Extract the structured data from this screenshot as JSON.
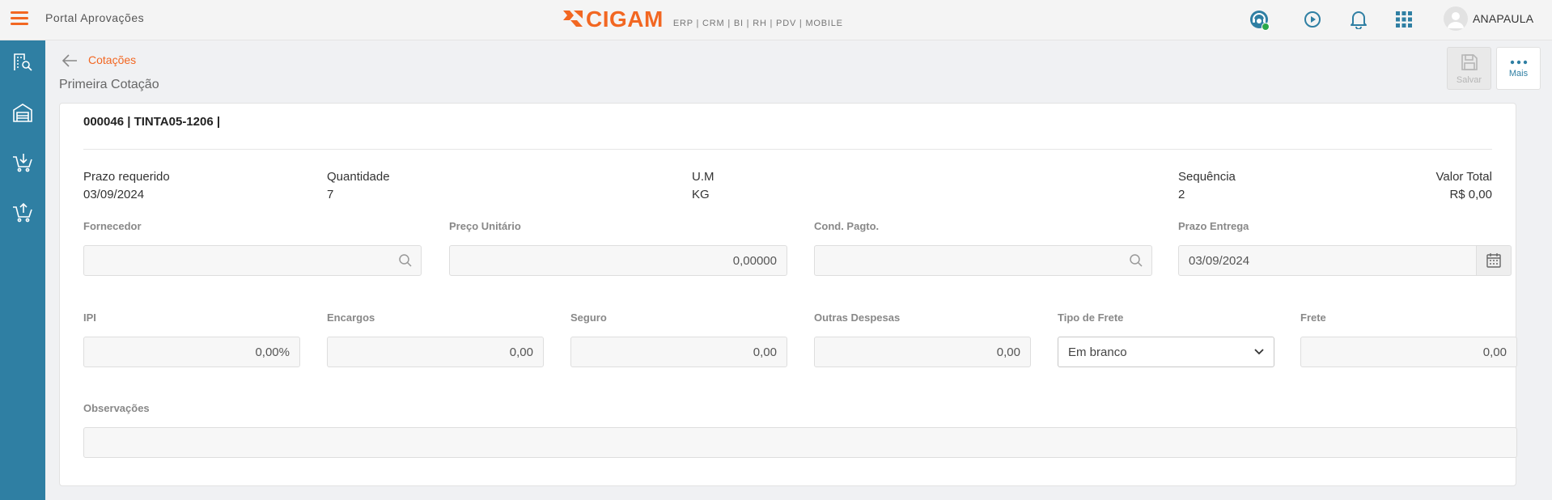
{
  "header": {
    "app_title": "Portal Aprovações",
    "logo_text": "CIGAM",
    "logo_tagline": "ERP | CRM | BI | RH | PDV | MOBILE",
    "user_name": "ANAPAULA"
  },
  "nav": {
    "breadcrumb": "Cotações",
    "page_title": "Primeira Cotação"
  },
  "actions": {
    "save_label": "Salvar",
    "more_label": "Mais"
  },
  "record": {
    "title": "000046 | TINTA05-1206 |",
    "prazo_requerido_label": "Prazo requerido",
    "prazo_requerido_value": "03/09/2024",
    "quantidade_label": "Quantidade",
    "quantidade_value": "7",
    "um_label": "U.M",
    "um_value": "KG",
    "sequencia_label": "Sequência",
    "sequencia_value": "2",
    "valor_total_label": "Valor Total",
    "valor_total_value": "R$ 0,00"
  },
  "form": {
    "fornecedor_label": "Fornecedor",
    "fornecedor_value": "",
    "preco_unitario_label": "Preço Unitário",
    "preco_unitario_value": "0,00000",
    "cond_pagto_label": "Cond. Pagto.",
    "cond_pagto_value": "",
    "prazo_entrega_label": "Prazo Entrega",
    "prazo_entrega_value": "03/09/2024",
    "ipi_label": "IPI",
    "ipi_value": "0,00%",
    "encargos_label": "Encargos",
    "encargos_value": "0,00",
    "seguro_label": "Seguro",
    "seguro_value": "0,00",
    "outras_despesas_label": "Outras Despesas",
    "outras_despesas_value": "0,00",
    "tipo_frete_label": "Tipo de Frete",
    "tipo_frete_value": "Em branco",
    "frete_label": "Frete",
    "frete_value": "0,00",
    "observacoes_label": "Observações",
    "observacoes_value": ""
  },
  "colors": {
    "brand_orange": "#f26722",
    "sidebar_blue": "#2f7fa3",
    "status_online": "#2aa84a"
  },
  "icons": {
    "menu": "hamburger-icon",
    "support": "support-agent-icon",
    "play": "play-circle-icon",
    "bell": "bell-icon",
    "apps": "apps-grid-icon",
    "user": "user-avatar-icon"
  }
}
